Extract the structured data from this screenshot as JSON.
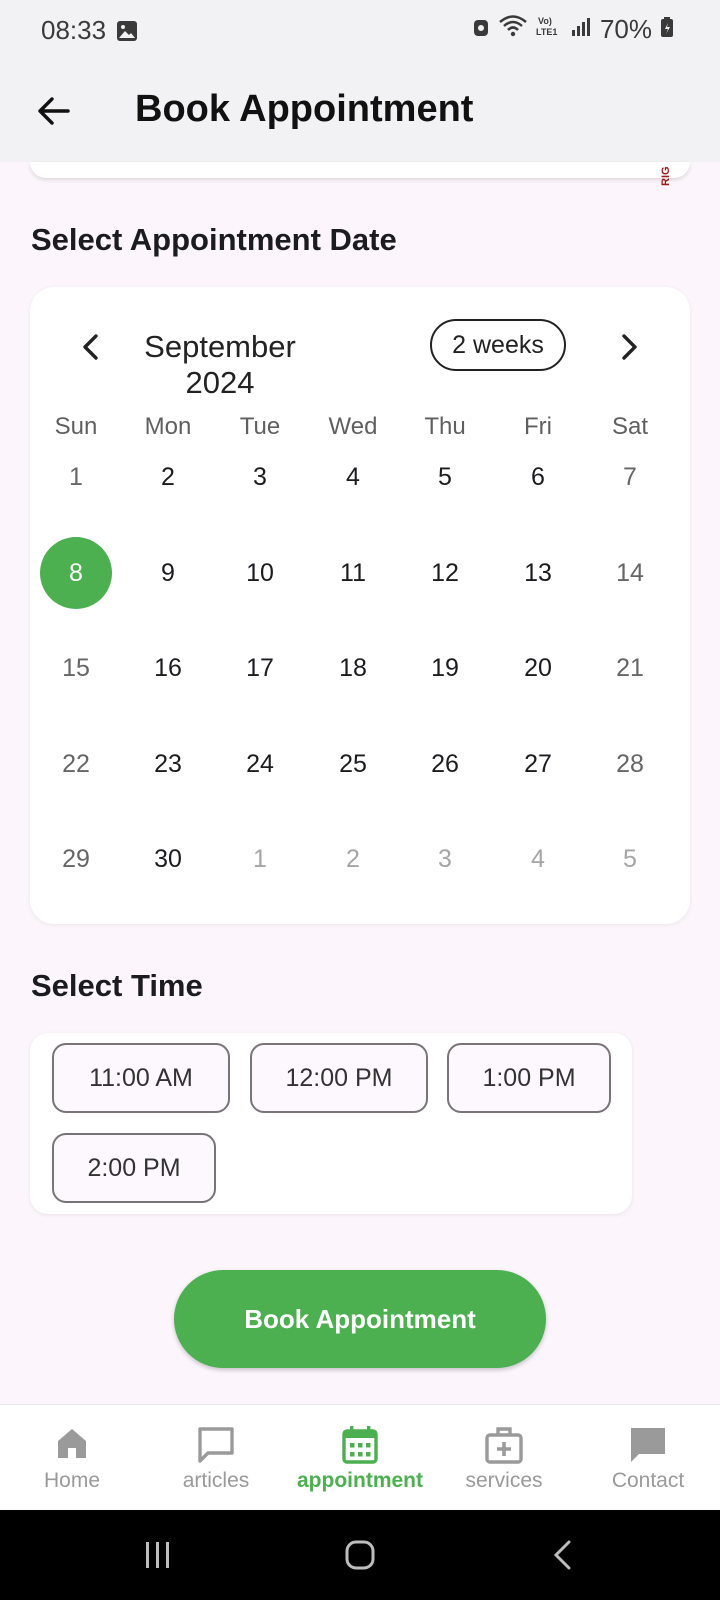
{
  "status_bar": {
    "time": "08:33",
    "battery": "70%",
    "icons": [
      "gallery-icon",
      "alarm-lock-icon",
      "wifi-icon",
      "volte-icon",
      "signal-icon",
      "battery-icon"
    ]
  },
  "app_bar": {
    "title": "Book Appointment",
    "back_icon": "arrow-left-icon"
  },
  "banner": {
    "text": "RIG"
  },
  "date_section": {
    "title": "Select Appointment Date",
    "calendar": {
      "month_label": "September 2024",
      "format_button": "2 weeks",
      "weekdays": [
        "Sun",
        "Mon",
        "Tue",
        "Wed",
        "Thu",
        "Fri",
        "Sat"
      ],
      "weeks": [
        [
          "1",
          "2",
          "3",
          "4",
          "5",
          "6",
          "7"
        ],
        [
          "8",
          "9",
          "10",
          "11",
          "12",
          "13",
          "14"
        ],
        [
          "15",
          "16",
          "17",
          "18",
          "19",
          "20",
          "21"
        ],
        [
          "22",
          "23",
          "24",
          "25",
          "26",
          "27",
          "28"
        ],
        [
          "29",
          "30",
          "1",
          "2",
          "3",
          "4",
          "5"
        ]
      ],
      "selected_day": "8",
      "colors": {
        "selected": "#4caf50",
        "outside_day": "#a5a5a5"
      }
    }
  },
  "time_section": {
    "title": "Select Time",
    "slots": [
      "11:00 AM",
      "12:00 PM",
      "1:00 PM",
      "2:00 PM"
    ]
  },
  "book_button": {
    "label": "Book Appointment",
    "color": "#4caf50"
  },
  "bottom_nav": {
    "items": [
      {
        "label": "Home",
        "icon": "home-icon",
        "active": false
      },
      {
        "label": "articles",
        "icon": "chat-bubble-icon",
        "active": false
      },
      {
        "label": "appointment",
        "icon": "calendar-icon",
        "active": true
      },
      {
        "label": "services",
        "icon": "medical-kit-icon",
        "active": false
      },
      {
        "label": "Contact",
        "icon": "message-icon",
        "active": false
      }
    ]
  },
  "system_nav": {
    "icons": [
      "recents-icon",
      "home-circle-icon",
      "back-chevron-icon"
    ]
  }
}
